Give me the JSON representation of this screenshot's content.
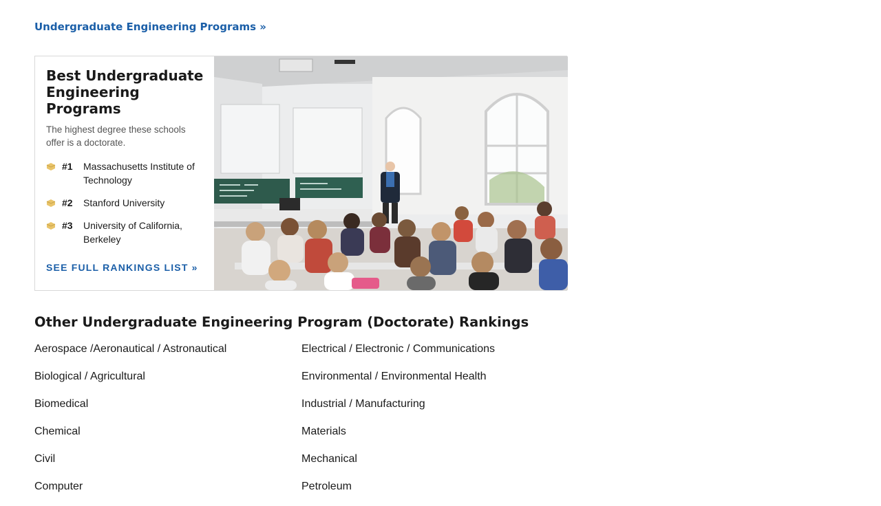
{
  "top_link": "Undergraduate Engineering Programs »",
  "feature": {
    "title": "Best Undergraduate Engineering Programs",
    "subtitle": "The highest degree these schools offer is a doctorate.",
    "rankings": [
      {
        "rank": "#1",
        "name": "Massachusetts Institute of Technology"
      },
      {
        "rank": "#2",
        "name": "Stanford University"
      },
      {
        "rank": "#3",
        "name": "University of California, Berkeley"
      }
    ],
    "see_full": "SEE FULL RANKINGS LIST »",
    "icon": "trophy-icon"
  },
  "other": {
    "heading": "Other Undergraduate Engineering Program (Doctorate) Rankings",
    "programs": [
      "Aerospace /Aeronautical / Astronautical",
      "Electrical / Electronic / Communications",
      "Biological / Agricultural",
      "Environmental / Environmental Health",
      "Biomedical",
      "Industrial / Manufacturing",
      "Chemical",
      "Materials",
      "Civil",
      "Mechanical",
      "Computer",
      "Petroleum"
    ]
  },
  "colors": {
    "link": "#1b5fa8",
    "text": "#1a1a1a",
    "muted": "#555555",
    "trophy": "#e9c46a"
  }
}
